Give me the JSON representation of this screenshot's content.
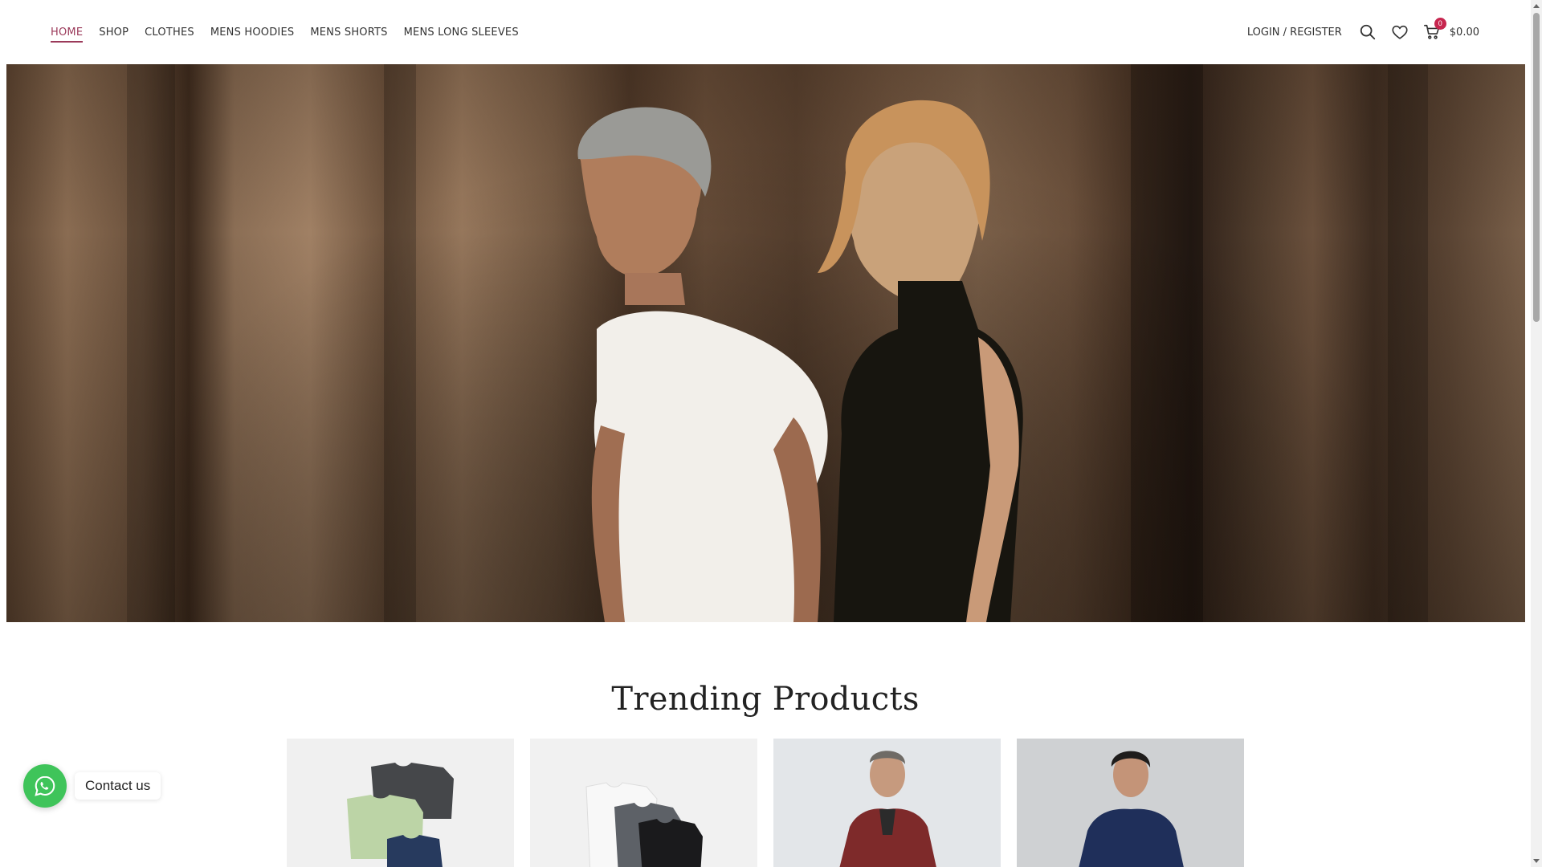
{
  "nav": {
    "items": [
      {
        "label": "HOME",
        "active": true
      },
      {
        "label": "SHOP",
        "active": false
      },
      {
        "label": "CLOTHES",
        "active": false
      },
      {
        "label": "MENS HOODIES",
        "active": false
      },
      {
        "label": "MENS SHORTS",
        "active": false
      },
      {
        "label": "MENS LONG SLEEVES",
        "active": false
      }
    ]
  },
  "header": {
    "login_label": "LOGIN / REGISTER",
    "search_icon": "search-icon",
    "wishlist_icon": "heart-icon",
    "cart_icon": "cart-icon",
    "cart_count": "0",
    "cart_total": "$0.00"
  },
  "hero": {
    "image": "couple-in-white-tshirt-and-black-dress"
  },
  "section": {
    "title": "Trending Products"
  },
  "products": [
    {
      "image": "folded-tshirts-black-green-navy"
    },
    {
      "image": "tshirts-white-grey-black"
    },
    {
      "image": "man-in-maroon-zip-sweater"
    },
    {
      "image": "man-in-navy-sweater"
    }
  ],
  "contact": {
    "label": "Contact us",
    "icon": "whatsapp-icon"
  },
  "colors": {
    "accent": "#9b3a5a",
    "badge": "#c7264f",
    "whatsapp": "#3fc45a"
  }
}
